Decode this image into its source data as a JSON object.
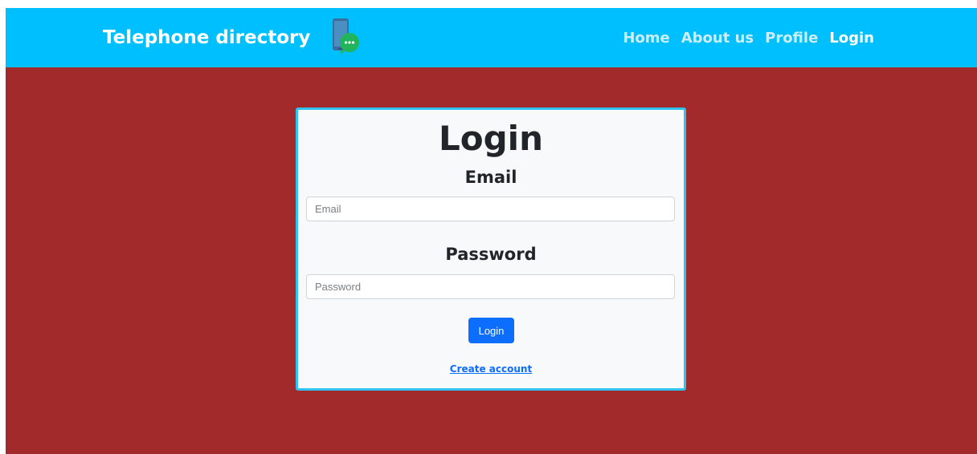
{
  "navbar": {
    "brand": "Telephone directory",
    "brand_icon": "phone-chat-icon",
    "links": [
      {
        "label": "Home",
        "active": false
      },
      {
        "label": "About us",
        "active": false
      },
      {
        "label": "Profile",
        "active": false
      },
      {
        "label": "Login",
        "active": true
      }
    ]
  },
  "login_form": {
    "title": "Login",
    "email_label": "Email",
    "email_placeholder": "Email",
    "email_value": "",
    "password_label": "Password",
    "password_placeholder": "Password",
    "password_value": "",
    "submit_label": "Login",
    "create_account_label": "Create account"
  },
  "colors": {
    "navbar_bg": "#00bffe",
    "page_bg": "#a32a2b",
    "card_border": "#2fc3f2",
    "button_bg": "#0d6efd",
    "link": "#0d6efd"
  }
}
